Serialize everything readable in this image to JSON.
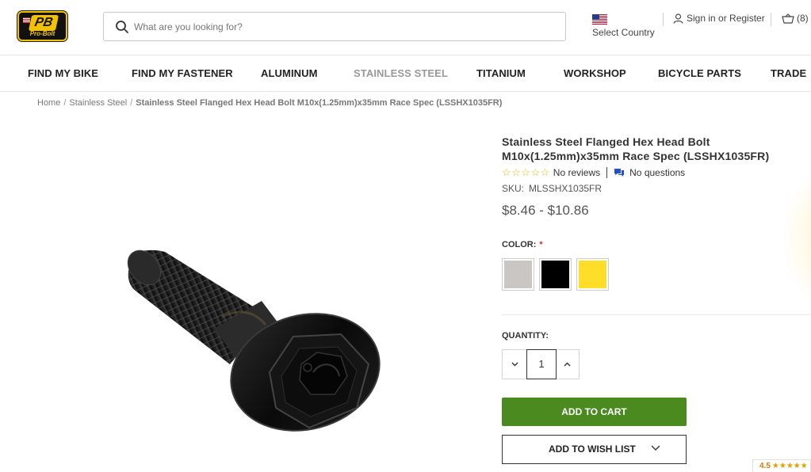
{
  "header": {
    "logo_text": "PB",
    "logo_sub": "Pro-Bolt",
    "search_placeholder": "What are you looking for?",
    "country_label": "Select Country",
    "signin_label": "Sign in or Register",
    "cart_count": "(8)"
  },
  "nav": {
    "items": [
      {
        "label": "FIND MY BIKE"
      },
      {
        "label": "FIND MY FASTENER"
      },
      {
        "label": "ALUMINUM"
      },
      {
        "label": "STAINLESS STEEL"
      },
      {
        "label": "TITANIUM"
      },
      {
        "label": "WORKSHOP"
      },
      {
        "label": "BICYCLE PARTS"
      },
      {
        "label": "TRADE"
      }
    ]
  },
  "breadcrumb": {
    "items": [
      "Home",
      "Stainless Steel"
    ],
    "current": "Stainless Steel Flanged Hex Head Bolt M10x(1.25mm)x35mm Race Spec (LSSHX1035FR)"
  },
  "product": {
    "title_line1": "Stainless Steel Flanged Hex Head Bolt",
    "title_line2": "M10x(1.25mm)x35mm Race Spec (LSSHX1035FR)",
    "stars": "☆☆☆☆☆",
    "reviews": "No reviews",
    "questions": "No questions",
    "sku_label": "SKU:",
    "sku": "MLSSHX1035FR",
    "price": "$8.46 - $10.86",
    "color_label": "COLOR:",
    "required_mark": "*",
    "swatches": [
      {
        "name": "silver",
        "color": "#c9c6c3"
      },
      {
        "name": "black",
        "color": "#000000"
      },
      {
        "name": "yellow",
        "color": "#ffde2a"
      }
    ],
    "quantity_label": "QUANTITY:",
    "quantity": "1",
    "add_to_cart": "ADD TO CART",
    "add_to_wish_list": "ADD TO WISH LIST"
  },
  "rating_badge": {
    "score": "4.5",
    "stars": "★★★★★"
  },
  "colors": {
    "accent_green": "#4a8a1f",
    "star_yellow": "#e5b800",
    "brand_yellow": "#f2c200"
  }
}
